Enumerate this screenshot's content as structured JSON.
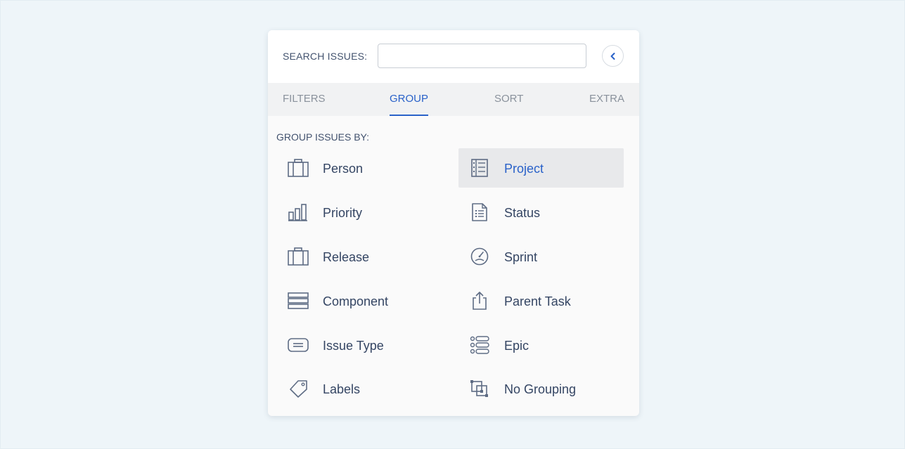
{
  "search": {
    "label": "SEARCH ISSUES:",
    "value": "",
    "placeholder": ""
  },
  "collapse_icon": "chevron-left-icon",
  "tabs": [
    {
      "label": "FILTERS",
      "active": false
    },
    {
      "label": "GROUP",
      "active": true
    },
    {
      "label": "SORT",
      "active": false
    },
    {
      "label": "EXTRA",
      "active": false
    }
  ],
  "group": {
    "heading": "GROUP ISSUES BY:",
    "selected": "Project",
    "options": [
      {
        "label": "Person",
        "icon": "briefcase-icon"
      },
      {
        "label": "Project",
        "icon": "project-list-icon"
      },
      {
        "label": "Priority",
        "icon": "bar-chart-icon"
      },
      {
        "label": "Status",
        "icon": "document-list-icon"
      },
      {
        "label": "Release",
        "icon": "package-icon"
      },
      {
        "label": "Sprint",
        "icon": "speedometer-icon"
      },
      {
        "label": "Component",
        "icon": "stacked-layers-icon"
      },
      {
        "label": "Parent Task",
        "icon": "upload-icon"
      },
      {
        "label": "Issue Type",
        "icon": "message-box-icon"
      },
      {
        "label": "Epic",
        "icon": "epic-list-icon"
      },
      {
        "label": "Labels",
        "icon": "tag-icon"
      },
      {
        "label": "No Grouping",
        "icon": "ungroup-icon"
      }
    ]
  },
  "colors": {
    "accent": "#2a62c9",
    "text": "#344563",
    "muted": "#8a929c",
    "background": "#eef5f9"
  }
}
